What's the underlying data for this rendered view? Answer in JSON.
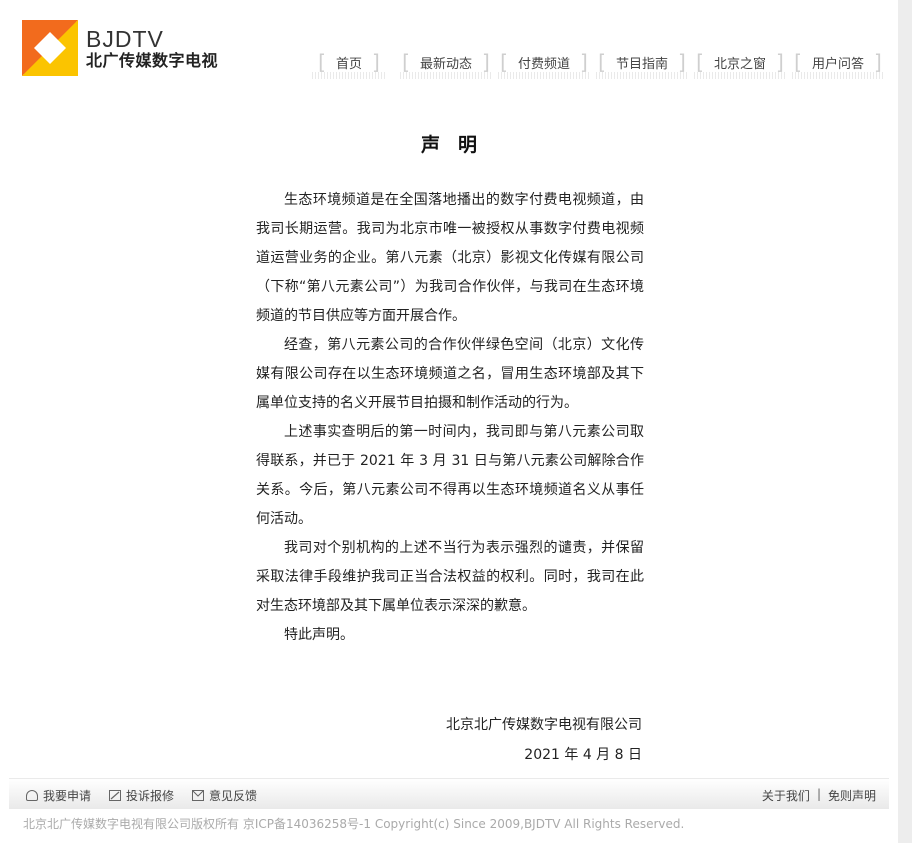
{
  "header": {
    "logo_en": "BJDTV",
    "logo_cn": "北广传媒数字电视",
    "nav": [
      "首页",
      "最新动态",
      "付费频道",
      "节目指南",
      "北京之窗",
      "用户问答"
    ]
  },
  "doc": {
    "title": "声明",
    "paragraphs": [
      "生态环境频道是在全国落地播出的数字付费电视频道，由我司长期运营。我司为北京市唯一被授权从事数字付费电视频道运营业务的企业。第八元素（北京）影视文化传媒有限公司（下称“第八元素公司”）为我司合作伙伴，与我司在生态环境频道的节目供应等方面开展合作。",
      "经查，第八元素公司的合作伙伴绿色空间（北京）文化传媒有限公司存在以生态环境频道之名，冒用生态环境部及其下属单位支持的名义开展节目拍摄和制作活动的行为。",
      "上述事实查明后的第一时间内，我司即与第八元素公司取得联系，并已于 2021 年 3 月 31 日与第八元素公司解除合作关系。今后，第八元素公司不得再以生态环境频道名义从事任何活动。",
      "我司对个别机构的上述不当行为表示强烈的谴责，并保留采取法律手段维护我司正当合法权益的权利。同时，我司在此对生态环境部及其下属单位表示深深的歉意。",
      "特此声明。"
    ],
    "signature_company": "北京北广传媒数字电视有限公司",
    "signature_date": "2021 年 4 月 8 日"
  },
  "footer": {
    "links": [
      {
        "label": "我要申请",
        "icon": "bulb-icon"
      },
      {
        "label": "投诉报修",
        "icon": "edit-icon"
      },
      {
        "label": "意见反馈",
        "icon": "mail-icon"
      }
    ],
    "right_links": [
      "关于我们",
      "免则声明"
    ],
    "right_sep": "|",
    "copyright": "北京北广传媒数字电视有限公司版权所有  京ICP备14036258号-1 Copyright(c) Since 2009,BJDTV All Rights Reserved."
  },
  "colors": {
    "logo_orange": "#f26b1d",
    "logo_yellow": "#fbc400",
    "nav_bracket": "#cfcfcf",
    "footer_text": "#444444",
    "copyright_text": "#aaaaaa"
  }
}
